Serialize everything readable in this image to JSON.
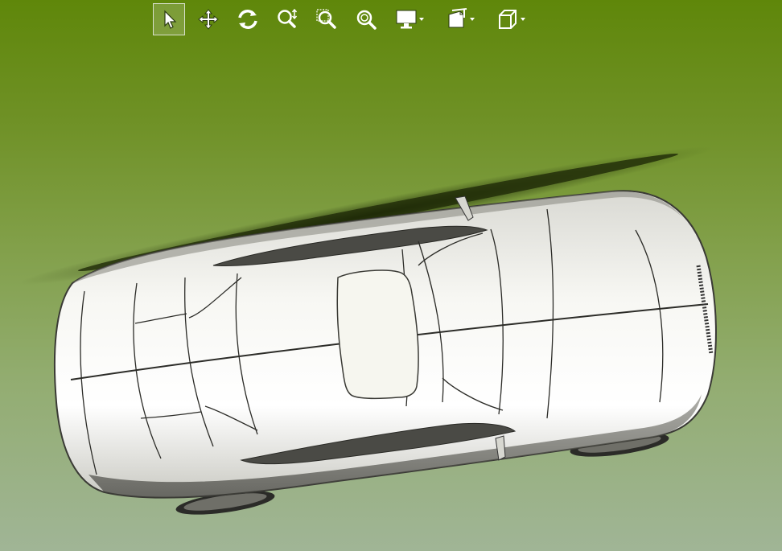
{
  "viewer": {
    "background_top": "#5f870a",
    "background_bottom": "#a0b596",
    "model_color": "#ededea"
  },
  "toolbar": {
    "tools": [
      {
        "id": "select",
        "icon": "select-arrow-icon",
        "active": true,
        "dropdown": false
      },
      {
        "id": "pan",
        "icon": "pan-move-icon",
        "active": false,
        "dropdown": false
      },
      {
        "id": "rotate",
        "icon": "rotate-icon",
        "active": false,
        "dropdown": false
      },
      {
        "id": "zoom",
        "icon": "zoom-icon",
        "active": false,
        "dropdown": false
      },
      {
        "id": "zoom-window",
        "icon": "zoom-window-icon",
        "active": false,
        "dropdown": false
      },
      {
        "id": "zoom-fit",
        "icon": "zoom-fit-icon",
        "active": false,
        "dropdown": false
      },
      {
        "id": "display",
        "icon": "display-monitor-icon",
        "active": false,
        "dropdown": true
      },
      {
        "id": "section",
        "icon": "section-plane-icon",
        "active": false,
        "dropdown": true
      },
      {
        "id": "view-cube",
        "icon": "view-cube-icon",
        "active": false,
        "dropdown": true
      }
    ]
  }
}
